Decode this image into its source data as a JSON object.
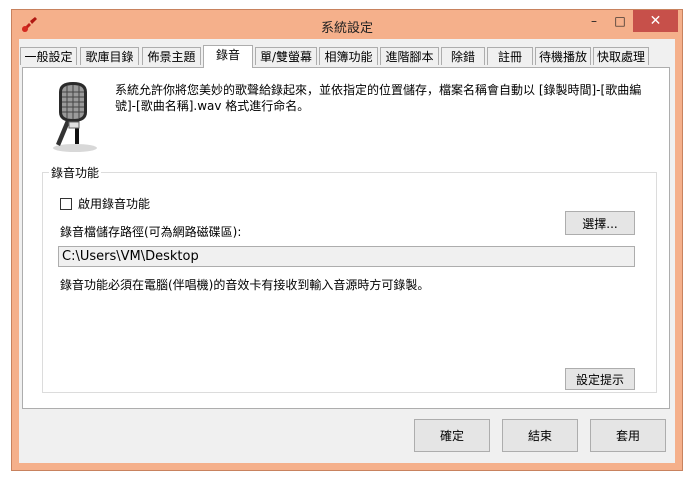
{
  "window": {
    "title": "系統設定"
  },
  "titlebar": {
    "minimize_glyph": "–",
    "maximize_glyph": "□",
    "close_glyph": "✕"
  },
  "tabs": [
    {
      "label": "一般設定"
    },
    {
      "label": "歌庫目錄"
    },
    {
      "label": "佈景主題"
    },
    {
      "label": "錄音",
      "active": true
    },
    {
      "label": "單/雙螢幕"
    },
    {
      "label": "相簿功能"
    },
    {
      "label": "進階腳本"
    },
    {
      "label": "除錯"
    },
    {
      "label": "註冊"
    },
    {
      "label": "待機播放"
    },
    {
      "label": "快取處理"
    }
  ],
  "recording": {
    "description": "系統允許你將您美妙的歌聲給錄起來，並依指定的位置儲存，檔案名稱會自動以 [錄製時間]-[歌曲編號]-[歌曲名稱].wav 格式進行命名。",
    "group_title": "錄音功能",
    "enable_label": "啟用錄音功能",
    "enable_checked": false,
    "path_label": "錄音檔儲存路徑(可為網路磁碟區):",
    "browse_label": "選擇...",
    "path_value": "C:\\Users\\VM\\Desktop",
    "note": "錄音功能必須在電腦(伴唱機)的音效卡有接收到輸入音源時方可錄製。",
    "tips_label": "設定提示"
  },
  "footer": {
    "ok_label": "確定",
    "close_label": "結束",
    "apply_label": "套用"
  },
  "icons": {
    "app": "guitar-icon",
    "recording": "microphone-icon"
  },
  "colors": {
    "frame": "#f5b08b",
    "close_button": "#c7504a"
  }
}
